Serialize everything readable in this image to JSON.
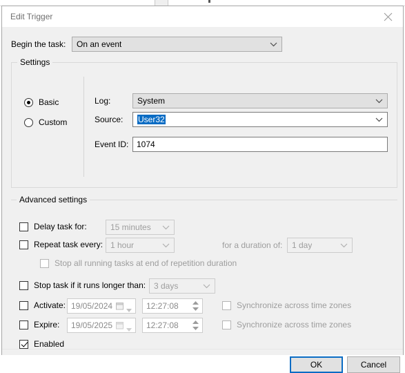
{
  "window": {
    "title": "Edit Trigger",
    "close_icon": "close-icon"
  },
  "begin": {
    "label": "Begin the task:",
    "value": "On an event"
  },
  "settings": {
    "group_title": "Settings",
    "mode_basic": "Basic",
    "mode_custom": "Custom",
    "selected_mode": "Basic",
    "log_label": "Log:",
    "log_value": "System",
    "source_label": "Source:",
    "source_value": "User32",
    "event_id_label": "Event ID:",
    "event_id_value": "1074"
  },
  "advanced": {
    "group_title": "Advanced settings",
    "delay_label": "Delay task for:",
    "delay_value": "15 minutes",
    "delay_checked": false,
    "repeat_label": "Repeat task every:",
    "repeat_value": "1 hour",
    "repeat_checked": false,
    "duration_label": "for a duration of:",
    "duration_value": "1 day",
    "stop_all_label": "Stop all running tasks at end of repetition duration",
    "stop_all_checked": false,
    "stop_longer_label": "Stop task if it runs longer than:",
    "stop_longer_value": "3 days",
    "stop_longer_checked": false,
    "activate_label": "Activate:",
    "activate_date": "19/05/2024",
    "activate_time": "12:27:08",
    "activate_checked": false,
    "expire_label": "Expire:",
    "expire_date": "19/05/2025",
    "expire_time": "12:27:08",
    "expire_checked": false,
    "sync_tz_label": "Synchronize across time zones",
    "enabled_label": "Enabled",
    "enabled_checked": true
  },
  "footer": {
    "ok_label": "OK",
    "cancel_label": "Cancel"
  },
  "colors": {
    "accent": "#0a6cc4",
    "dialog_bg": "#f0f0f0",
    "disabled_text": "#9d9d9d"
  }
}
